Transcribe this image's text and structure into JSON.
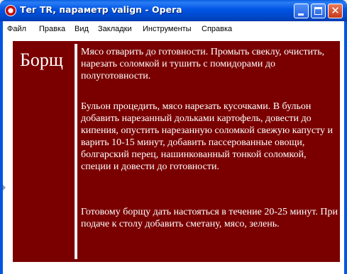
{
  "window": {
    "title": "Тег TR, параметр valign - Opera"
  },
  "menubar": {
    "items": [
      "Файл",
      "Правка",
      "Вид",
      "Закладки",
      "Инструменты",
      "Справка"
    ]
  },
  "recipe": {
    "heading": "Борщ",
    "paragraphs": [
      "Мясо отварить до готовности. Промыть свеклу, очистить, нарезать соломкой и тушить с помидорами до полуготовности.",
      "Бульон процедить, мясо нарезать кусочками. В бульон добавить нарезанный дольками картофель, довести до кипения, опустить нарезанную соломкой свежую капусту и варить 10-15 минут, добавить пассерованные овощи, болгарский перец, нашинкованный тонкой соломкой, специи и довести до готовности.",
      "Готовому борщу дать настояться в течение 20-25 минут. При подаче к столу добавить сметану, мясо, зелень."
    ]
  },
  "colors": {
    "table_background": "#7a0000",
    "titlebar": "#0054e3",
    "text_on_table": "#ffffff"
  },
  "icons": [
    "opera-icon",
    "minimize-icon",
    "maximize-icon",
    "close-icon"
  ]
}
